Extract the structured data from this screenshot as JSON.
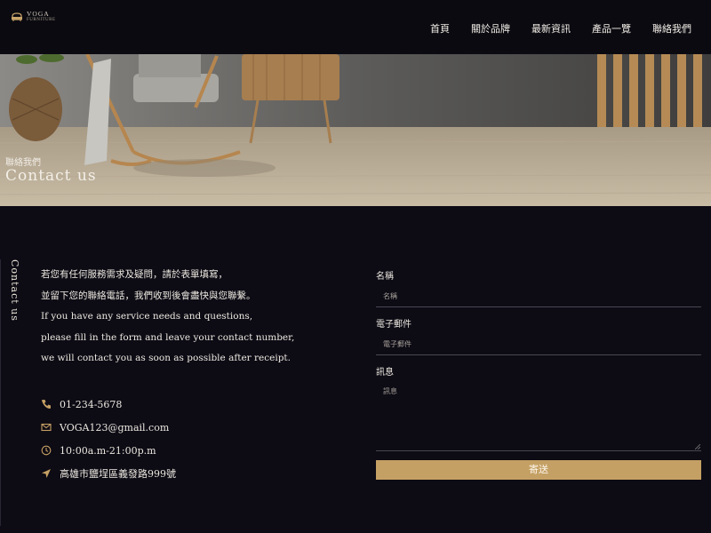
{
  "header": {
    "logo": {
      "name": "VOGA",
      "sub": "FURNITURE"
    },
    "nav": [
      "首頁",
      "關於品牌",
      "最新資訊",
      "產品一覽",
      "聯絡我們"
    ]
  },
  "hero": {
    "subtitle": "聯絡我們",
    "title": "Contact us"
  },
  "side_label": "Contact us",
  "intro": [
    "若您有任何服務需求及疑問，請於表單填寫，",
    "並留下您的聯絡電話，我們收到後會盡快與您聯繫。",
    "If you have any service needs and questions,",
    "please fill in the form and leave your contact number,",
    "we will contact you as soon as possible after receipt."
  ],
  "contact": {
    "phone": "01-234-5678",
    "email": "VOGA123@gmail.com",
    "hours": "10:00a.m-21:00p.m",
    "address": "高雄市鹽埕區義發路999號",
    "icons": [
      "phone-icon",
      "mail-icon",
      "clock-icon",
      "location-arrow-icon"
    ],
    "icon_color": "#c5a064"
  },
  "form": {
    "name_label": "名稱",
    "name_placeholder": "名稱",
    "email_label": "電子郵件",
    "email_placeholder": "電子郵件",
    "message_label": "訊息",
    "message_placeholder": "訊息",
    "submit_label": "寄送"
  },
  "colors": {
    "accent": "#c5a064",
    "background": "#0d0b14"
  }
}
